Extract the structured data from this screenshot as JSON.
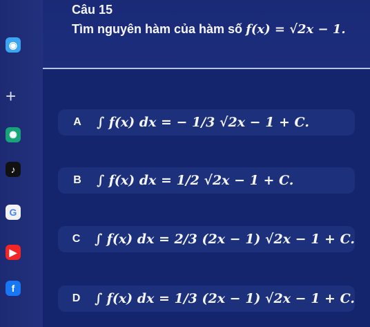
{
  "question": {
    "number": "Câu 15",
    "text_prefix": "Tìm nguyên hàm của hàm số",
    "function": "f(x) = √2x − 1."
  },
  "answers": [
    {
      "letter": "A",
      "formula": "∫ f(x) dx = − 1/3 √2x − 1 + C."
    },
    {
      "letter": "B",
      "formula": "∫ f(x) dx = 1/2 √2x − 1 + C."
    },
    {
      "letter": "C",
      "formula": "∫ f(x) dx = 2/3 (2x − 1) √2x − 1 + C."
    },
    {
      "letter": "D",
      "formula": "∫ f(x) dx = 1/3 (2x − 1) √2x − 1 + C."
    }
  ],
  "sidebar": {
    "icons": [
      {
        "name": "avatar-icon",
        "color": "#3ba5f1"
      },
      {
        "name": "chatgpt-icon",
        "color": "#19a37a"
      },
      {
        "name": "tiktok-icon",
        "color": "#111111"
      },
      {
        "name": "google-icon",
        "color": "#f2f2f2"
      },
      {
        "name": "youtube-icon",
        "color": "#f42525"
      },
      {
        "name": "facebook-icon",
        "color": "#1877f2"
      }
    ]
  }
}
